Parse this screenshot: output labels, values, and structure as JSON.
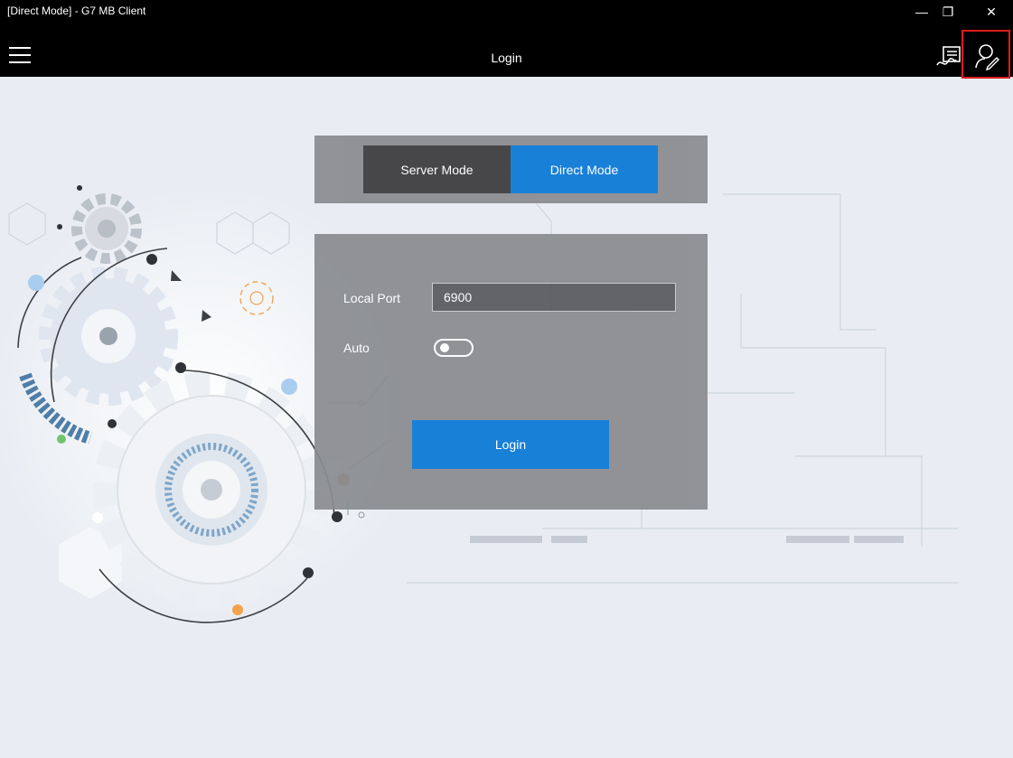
{
  "window": {
    "title": "[Direct Mode] - G7 MB Client",
    "minimize": "—",
    "restore": "❐",
    "close": "✕"
  },
  "header": {
    "menu_icon": "hamburger-icon",
    "title": "Login",
    "icons": [
      "signature-icon",
      "user-edit-icon"
    ]
  },
  "mode_switch": {
    "server_mode": "Server Mode",
    "direct_mode": "Direct Mode",
    "selected": "Direct Mode"
  },
  "login_form": {
    "local_port_label": "Local Port",
    "local_port_value": "6900",
    "auto_label": "Auto",
    "auto_enabled": false,
    "login_button": "Login"
  },
  "colors": {
    "accent": "#0a78d7",
    "titlebar": "#000000",
    "panel": "#8a8c90",
    "highlight": "#e01b1b"
  }
}
